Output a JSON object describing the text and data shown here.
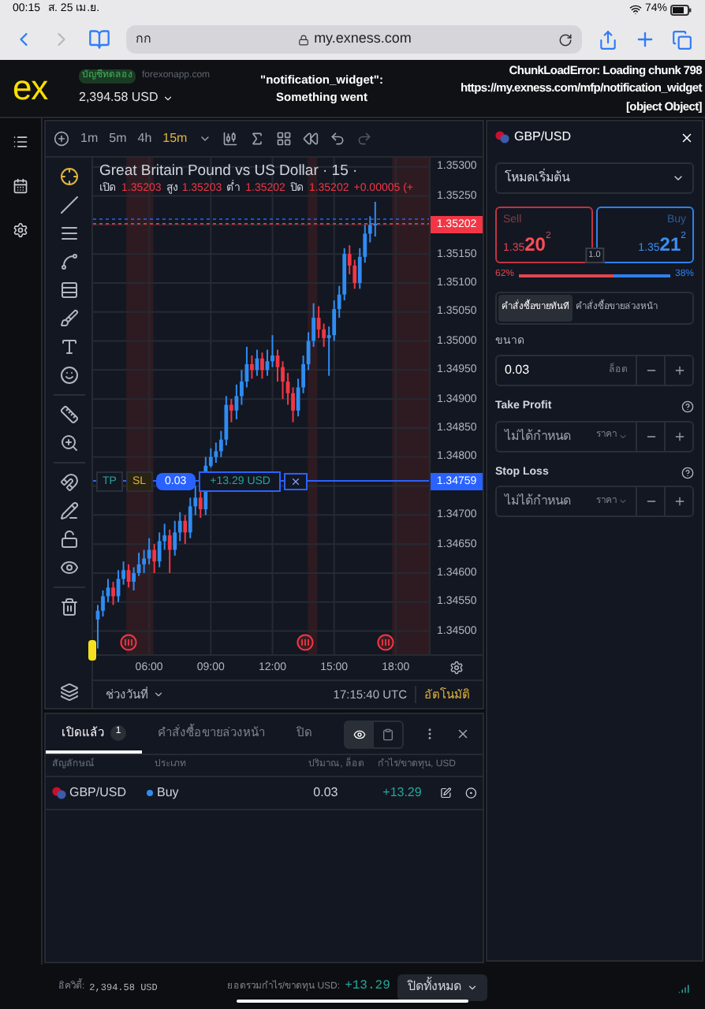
{
  "status_bar": {
    "time": "00:15",
    "date": "ส. 25 เม.ย.",
    "battery": "74%"
  },
  "browser": {
    "text_size_button": "กก",
    "url": "my.exness.com",
    "forward_disabled": true
  },
  "header": {
    "logo": "ex",
    "account_type": "บัญชีทดลอง",
    "server": "forexonapp.com",
    "balance": "2,394.58 USD",
    "error_left": [
      "\"notification_widget\":",
      "Something went"
    ],
    "error_right": [
      "ChunkLoadError: Loading chunk 798",
      "https://my.exness.com/mfp/notification_widget",
      "[object Object]"
    ]
  },
  "chart": {
    "timeframes": [
      {
        "label": "1m",
        "selected": false
      },
      {
        "label": "5m",
        "selected": false
      },
      {
        "label": "4h",
        "selected": false
      },
      {
        "label": "15m",
        "selected": true
      }
    ],
    "title": "Great Britain Pound vs US Dollar · 15 ·",
    "ohlc": [
      {
        "label": "เปิด",
        "value": "1.35203"
      },
      {
        "label": "สูง",
        "value": "1.35203"
      },
      {
        "label": "ต่ำ",
        "value": "1.35202"
      },
      {
        "label": "ปิด",
        "value": "1.35202"
      }
    ],
    "change": "+0.00005 (+",
    "chart_data": {
      "type": "candlestick",
      "x": [
        3.5,
        3.75,
        4,
        4.25,
        4.5,
        4.75,
        5,
        5.25,
        5.5,
        5.75,
        6,
        6.25,
        6.5,
        6.75,
        7,
        7.25,
        7.5,
        7.75,
        8,
        8.25,
        8.5,
        8.75,
        9,
        9.25,
        9.5,
        9.75,
        10,
        10.25,
        10.5,
        10.75,
        11,
        11.25,
        11.5,
        11.75,
        12,
        12.25,
        12.5,
        12.75,
        13,
        13.25,
        13.5,
        13.75,
        14,
        14.25,
        14.5,
        14.75,
        15,
        15.25,
        15.5,
        15.75,
        16,
        16.25,
        16.5,
        16.75,
        17
      ],
      "ohlc": [
        [
          1.3452,
          1.34545,
          1.3447,
          1.34535
        ],
        [
          1.34535,
          1.3457,
          1.34525,
          1.3456
        ],
        [
          1.3456,
          1.3459,
          1.3455,
          1.34575
        ],
        [
          1.34575,
          1.34585,
          1.34545,
          1.3456
        ],
        [
          1.3456,
          1.34605,
          1.3455,
          1.3459
        ],
        [
          1.3459,
          1.3462,
          1.3458,
          1.34605
        ],
        [
          1.34605,
          1.34615,
          1.34575,
          1.34585
        ],
        [
          1.34585,
          1.3461,
          1.3457,
          1.346
        ],
        [
          1.346,
          1.34635,
          1.34595,
          1.34615
        ],
        [
          1.34615,
          1.3464,
          1.346,
          1.34625
        ],
        [
          1.34625,
          1.3466,
          1.34615,
          1.3464
        ],
        [
          1.3464,
          1.3465,
          1.346,
          1.3462
        ],
        [
          1.3462,
          1.3467,
          1.3461,
          1.34655
        ],
        [
          1.34655,
          1.34685,
          1.3464,
          1.34665
        ],
        [
          1.34665,
          1.34675,
          1.346,
          1.3464
        ],
        [
          1.3464,
          1.3469,
          1.3463,
          1.3467
        ],
        [
          1.3467,
          1.34705,
          1.34655,
          1.3469
        ],
        [
          1.3469,
          1.347,
          1.3465,
          1.3467
        ],
        [
          1.3467,
          1.3473,
          1.3466,
          1.34715
        ],
        [
          1.34715,
          1.3475,
          1.347,
          1.3473
        ],
        [
          1.3473,
          1.3474,
          1.34695,
          1.3471
        ],
        [
          1.3471,
          1.348,
          1.347,
          1.34785
        ],
        [
          1.34785,
          1.34815,
          1.34782,
          1.348
        ],
        [
          1.348,
          1.34825,
          1.3479,
          1.3481
        ],
        [
          1.3481,
          1.34845,
          1.348,
          1.3483
        ],
        [
          1.3483,
          1.34905,
          1.3482,
          1.3489
        ],
        [
          1.3489,
          1.349,
          1.3486,
          1.3488
        ],
        [
          1.3488,
          1.34925,
          1.34865,
          1.34905
        ],
        [
          1.34905,
          1.3495,
          1.3489,
          1.3493
        ],
        [
          1.3493,
          1.3499,
          1.3492,
          1.3496
        ],
        [
          1.3496,
          1.34975,
          1.34935,
          1.3495
        ],
        [
          1.3495,
          1.34985,
          1.3494,
          1.3497
        ],
        [
          1.3497,
          1.3498,
          1.34935,
          1.3495
        ],
        [
          1.3495,
          1.34985,
          1.3494,
          1.34965
        ],
        [
          1.34965,
          1.3501,
          1.34955,
          1.34975
        ],
        [
          1.34975,
          1.34985,
          1.3493,
          1.34955
        ],
        [
          1.34955,
          1.34965,
          1.349,
          1.3493
        ],
        [
          1.3493,
          1.34945,
          1.3489,
          1.3491
        ],
        [
          1.3491,
          1.3492,
          1.3486,
          1.3488
        ],
        [
          1.3488,
          1.34935,
          1.3487,
          1.3492
        ],
        [
          1.3492,
          1.34975,
          1.3491,
          1.3496
        ],
        [
          1.3496,
          1.35015,
          1.3495,
          1.35
        ],
        [
          1.35,
          1.35065,
          1.3499,
          1.3504
        ],
        [
          1.3504,
          1.3506,
          1.35005,
          1.3502
        ],
        [
          1.3502,
          1.3503,
          1.3499,
          1.35005
        ],
        [
          1.35005,
          1.35025,
          1.3494,
          1.3501
        ],
        [
          1.3501,
          1.3507,
          1.35,
          1.35055
        ],
        [
          1.35055,
          1.35095,
          1.3504,
          1.3508
        ],
        [
          1.3508,
          1.3516,
          1.3507,
          1.3515
        ],
        [
          1.3515,
          1.35165,
          1.35115,
          1.3513
        ],
        [
          1.3513,
          1.3514,
          1.3509,
          1.351
        ],
        [
          1.351,
          1.3516,
          1.3509,
          1.35145
        ],
        [
          1.35145,
          1.352,
          1.35135,
          1.35185
        ],
        [
          1.35185,
          1.35215,
          1.3517,
          1.352
        ],
        [
          1.352,
          1.3524,
          1.3518,
          1.35202
        ]
      ],
      "xlim": [
        3.27,
        22.38
      ],
      "ylim": [
        1.3446,
        1.35316
      ],
      "grid": true,
      "bands": [
        {
          "axis": "x",
          "from": 4.89,
          "to": 6.21,
          "color": "#2e1b21"
        },
        {
          "axis": "x",
          "from": 13.72,
          "to": 14.18,
          "color": "#2e1b21"
        },
        {
          "axis": "x",
          "from": 17.82,
          "to": 19.75,
          "color": "#2e1b21"
        }
      ],
      "ref_lines": [
        {
          "axis": "y",
          "value": 1.3521,
          "color": "#2962ff"
        },
        {
          "axis": "y",
          "value": 1.35202,
          "color": "#f23645",
          "label": "1.35202"
        },
        {
          "axis": "y",
          "value": 1.34759,
          "color": "#2962ff",
          "label": "1.34759"
        }
      ],
      "yticks": [
        {
          "value": 1.353,
          "label": "1.35300"
        },
        {
          "value": 1.3525,
          "label": "1.35250"
        },
        {
          "value": 1.3515,
          "label": "1.35150"
        },
        {
          "value": 1.351,
          "label": "1.35100"
        },
        {
          "value": 1.3505,
          "label": "1.35050"
        },
        {
          "value": 1.35,
          "label": "1.35000"
        },
        {
          "value": 1.3495,
          "label": "1.34950"
        },
        {
          "value": 1.349,
          "label": "1.34900"
        },
        {
          "value": 1.3485,
          "label": "1.34850"
        },
        {
          "value": 1.348,
          "label": "1.34800"
        },
        {
          "value": 1.347,
          "label": "1.34700"
        },
        {
          "value": 1.3465,
          "label": "1.34650"
        },
        {
          "value": 1.346,
          "label": "1.34600"
        },
        {
          "value": 1.3455,
          "label": "1.34550"
        },
        {
          "value": 1.345,
          "label": "1.34500"
        }
      ],
      "xticks": [
        {
          "value": 6,
          "label": "06:00"
        },
        {
          "value": 9,
          "label": "09:00"
        },
        {
          "value": 12,
          "label": "12:00"
        },
        {
          "value": 15,
          "label": "15:00"
        },
        {
          "value": 18,
          "label": "18:00"
        }
      ]
    },
    "position": {
      "tp": "TP",
      "sl": "SL",
      "volume": "0.03",
      "profit": "+13.29 USD"
    },
    "date_range": "ช่วงวันที่",
    "clock": "17:15:40 UTC",
    "auto": "อัตโนมัติ"
  },
  "order_panel": {
    "symbol": "GBP/USD",
    "mode": "โหมดเริ่มต้น",
    "sell": {
      "label": "Sell",
      "price_prefix": "1.35",
      "price_big": "20",
      "price_sup": "2"
    },
    "buy": {
      "label": "Buy",
      "price_prefix": "1.35",
      "price_big": "21",
      "price_sup": "2"
    },
    "spread": "1.0",
    "sentiment": {
      "sell_percent": "62%",
      "buy_percent": "38%",
      "level": 0.62
    },
    "tabs": [
      {
        "label": "คำสั่งซื้อขายทันที",
        "selected": true
      },
      {
        "label": "คำสั่งซื้อขายล่วงหน้า",
        "selected": false
      }
    ],
    "volume": {
      "label": "ขนาด",
      "value": "0.03",
      "unit": "ล็อต"
    },
    "take_profit": {
      "label": "Take Profit",
      "placeholder": "ไม่ได้กำหนด",
      "mode": "ราคา"
    },
    "stop_loss": {
      "label": "Stop Loss",
      "placeholder": "ไม่ได้กำหนด",
      "mode": "ราคา"
    }
  },
  "positions": {
    "tabs": [
      {
        "label": "เปิดแล้ว",
        "count": "1",
        "selected": true
      },
      {
        "label": "คำสั่งซื้อขายล่วงหน้า",
        "selected": false
      },
      {
        "label": "ปิด",
        "selected": false
      }
    ],
    "view_modes": [
      {
        "selected": true
      },
      {
        "selected": false
      }
    ],
    "columns": [
      "สัญลักษณ์",
      "ประเภท",
      "ปริมาณ, ล็อต",
      "กำไร/ขาดทุน, USD"
    ],
    "rows": [
      {
        "symbol": "GBP/USD",
        "type": "Buy",
        "volume": "0.03",
        "profit": "+13.29"
      }
    ]
  },
  "footer": {
    "equity_label": "อิควิตี้:",
    "equity": "2,394.58 USD",
    "total_label": "ยอดรวมกำไร/ขาดทุน USD:",
    "total": "+13.29",
    "close_all": "ปิดทั้งหมด"
  }
}
